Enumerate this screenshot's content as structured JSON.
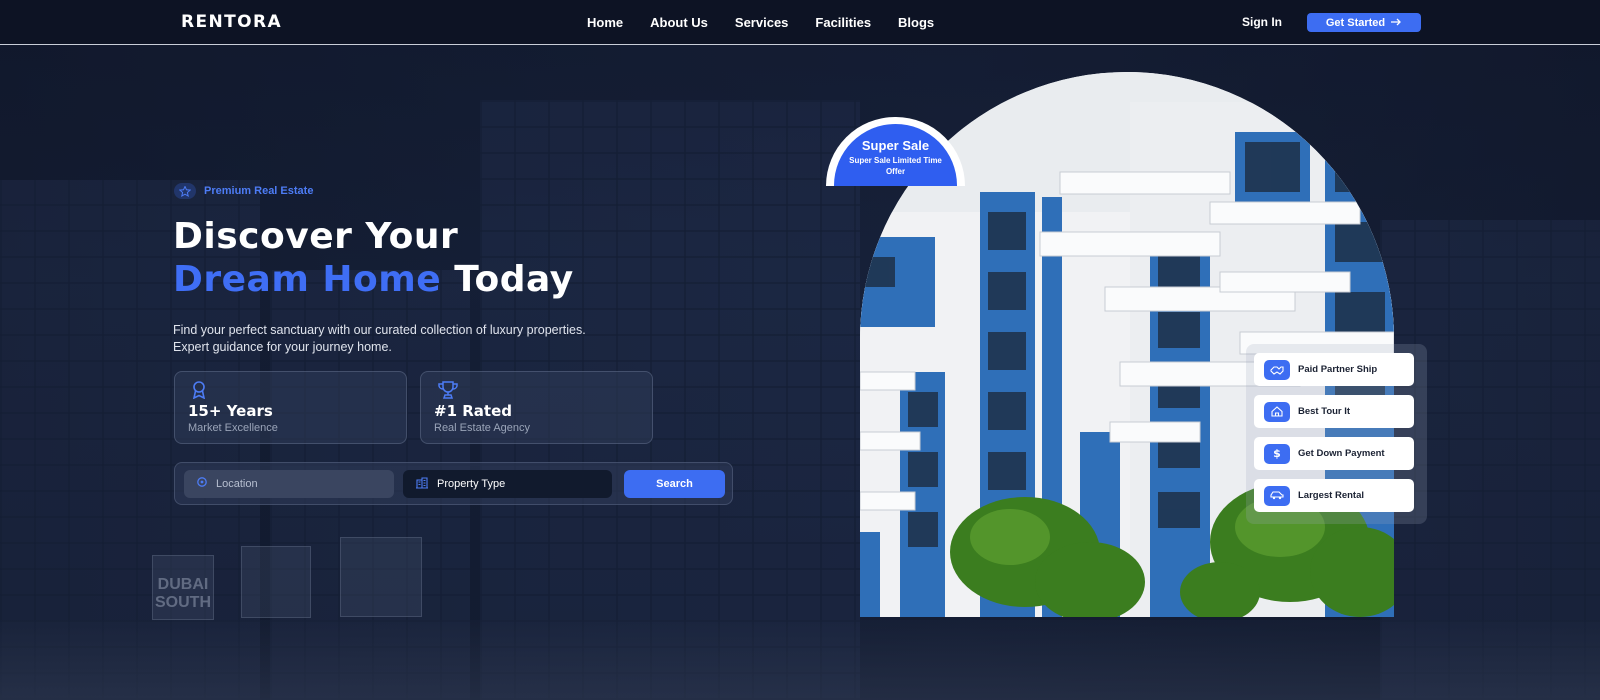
{
  "nav": {
    "logo": "RENTORA",
    "links": [
      "Home",
      "About Us",
      "Services",
      "Facilities",
      "Blogs"
    ],
    "sign_in": "Sign In",
    "cta": "Get Started"
  },
  "hero": {
    "badge": "Premium Real Estate",
    "title_line1": "Discover Your",
    "title_accent": "Dream Home",
    "title_rest": "Today",
    "subtitle_line1": "Find your perfect sanctuary with our curated collection of luxury properties.",
    "subtitle_line2": "Expert guidance for your journey home.",
    "stats": [
      {
        "value": "15+ Years",
        "label": "Market Excellence",
        "icon": "award-ribbon-icon"
      },
      {
        "value": "#1 Rated",
        "label": "Real Estate Agency",
        "icon": "trophy-icon"
      }
    ]
  },
  "search": {
    "location_placeholder": "Location",
    "property_type": "Property Type",
    "button": "Search"
  },
  "promo": {
    "title": "Super Sale",
    "subtitle": "Super Sale Limited Time Offer"
  },
  "features": [
    {
      "label": "Paid Partner Ship",
      "icon": "handshake-icon"
    },
    {
      "label": "Best Tour It",
      "icon": "home-icon"
    },
    {
      "label": "Get Down Payment",
      "icon": "dollar-icon"
    },
    {
      "label": "Largest Rental",
      "icon": "car-icon"
    }
  ],
  "colors": {
    "accent": "#3d6df2",
    "background": "#0e1526",
    "building_blue": "#2f6fb8"
  }
}
